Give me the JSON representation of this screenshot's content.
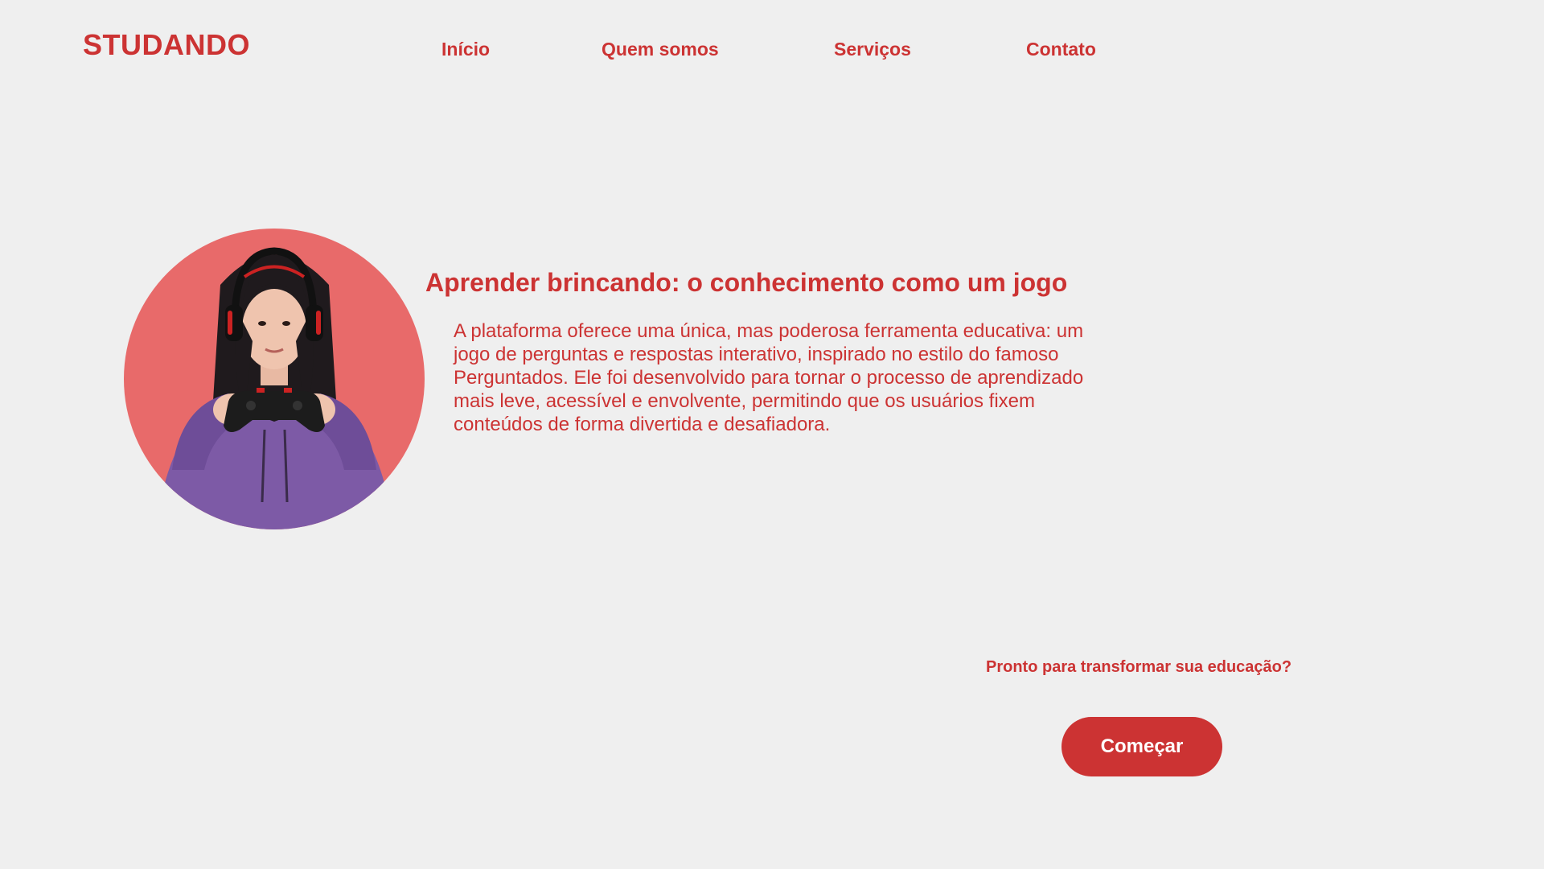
{
  "header": {
    "logo": "STUDANDO",
    "nav": {
      "inicio": "Início",
      "quem_somos": "Quem somos",
      "servicos": "Serviços",
      "contato": "Contato"
    }
  },
  "hero": {
    "image_alt": "gamer-girl-with-controller",
    "title": "Aprender brincando: o conhecimento como um jogo",
    "text": "A plataforma oferece uma única, mas poderosa ferramenta educativa: um jogo de perguntas e respostas interativo, inspirado no estilo do famoso Perguntados. Ele foi desenvolvido para tornar o processo de aprendizado mais leve, acessível e envolvente, permitindo que os usuários fixem conteúdos de forma divertida e desafiadora."
  },
  "cta": {
    "question": "Pronto para transformar sua educação?",
    "button_label": "Começar"
  },
  "colors": {
    "background": "#efefef",
    "accent": "#cc3333",
    "avatar_bg": "#e86a6a",
    "hoodie": "#7d5aa6"
  }
}
